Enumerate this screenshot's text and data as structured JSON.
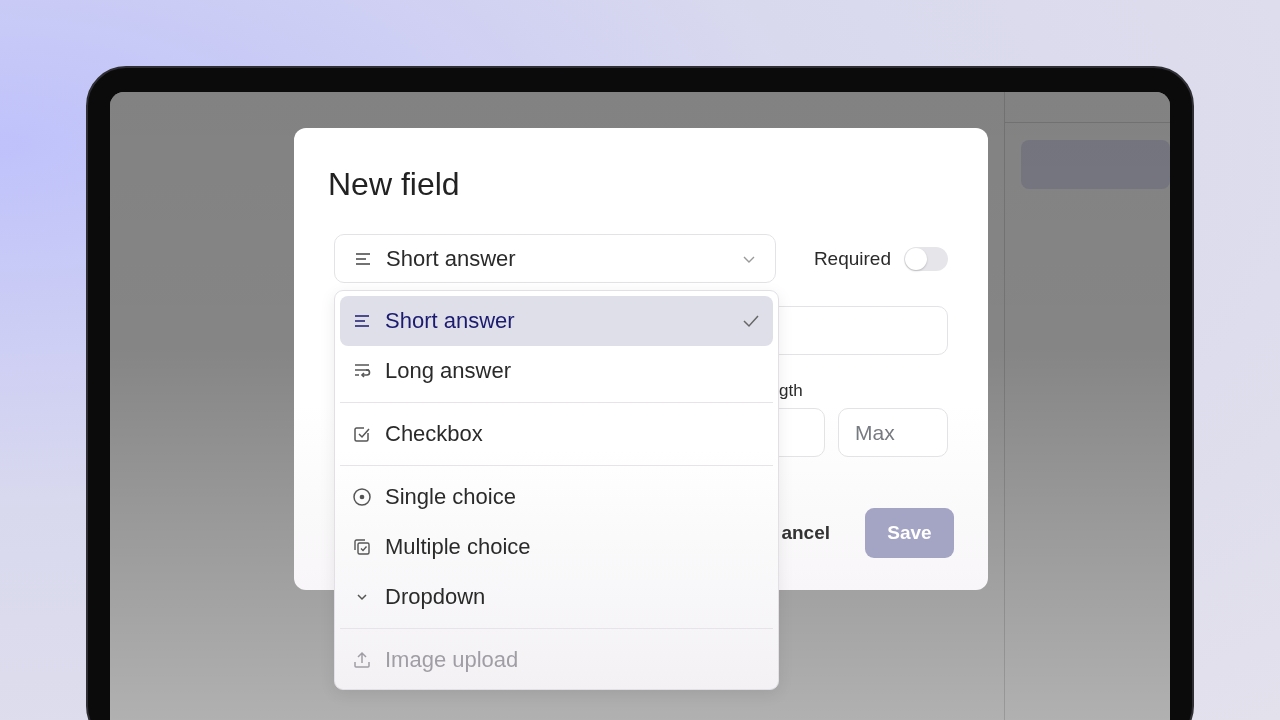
{
  "dialog": {
    "title": "New field",
    "type_select": {
      "kind": "short",
      "value": "Short answer"
    },
    "required": {
      "label": "Required",
      "on": false
    },
    "length_label": "gth",
    "max_field": {
      "placeholder": "Max"
    },
    "cancel": "ancel",
    "save": {
      "label": "Save",
      "disabled": true
    }
  },
  "menu": {
    "groups": [
      [
        {
          "kind": "short",
          "label": "Short answer",
          "selected": true,
          "disabled": false
        },
        {
          "kind": "long",
          "label": "Long answer",
          "selected": false,
          "disabled": false
        }
      ],
      [
        {
          "kind": "checkbox",
          "label": "Checkbox",
          "selected": false,
          "disabled": false
        }
      ],
      [
        {
          "kind": "single",
          "label": "Single choice",
          "selected": false,
          "disabled": false
        },
        {
          "kind": "multiple",
          "label": "Multiple choice",
          "selected": false,
          "disabled": false
        },
        {
          "kind": "dropdown",
          "label": "Dropdown",
          "selected": false,
          "disabled": false
        }
      ],
      [
        {
          "kind": "upload",
          "label": "Image upload",
          "selected": false,
          "disabled": true
        }
      ]
    ]
  }
}
